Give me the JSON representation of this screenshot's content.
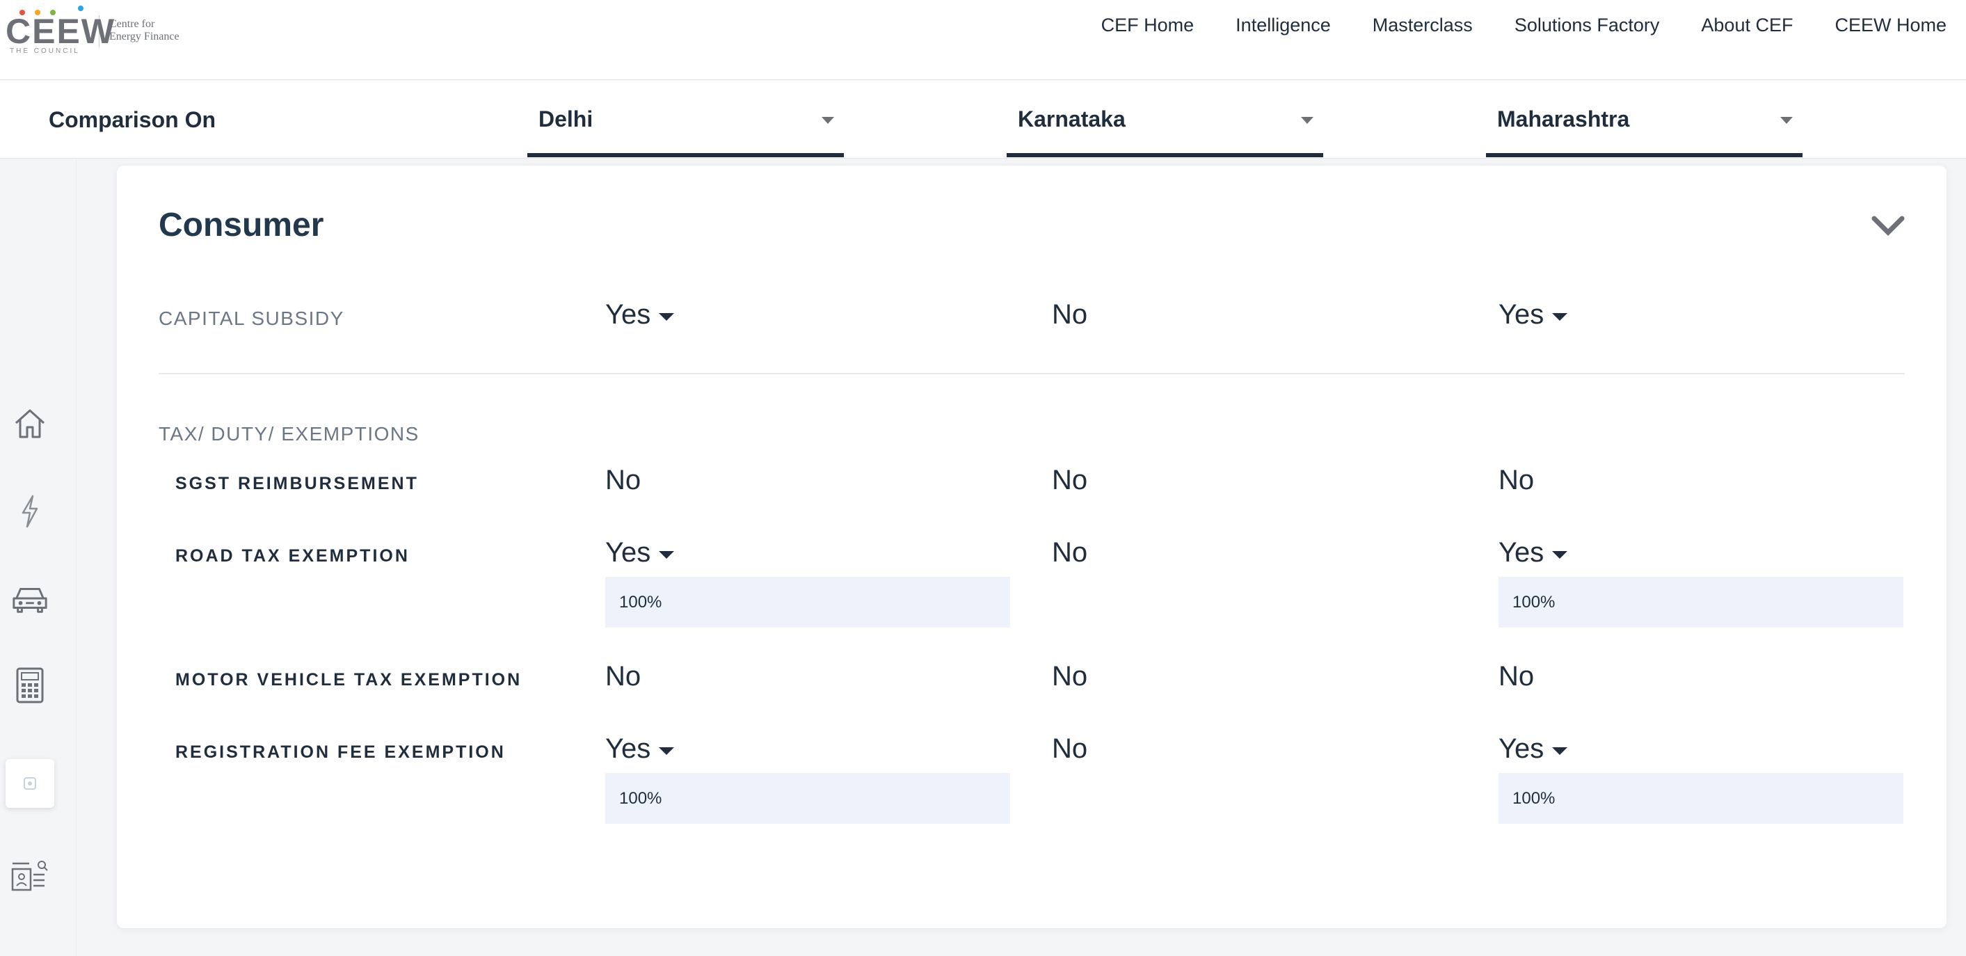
{
  "header": {
    "logo": {
      "wordmark": "CEEW",
      "sub": "THE COUNCIL",
      "tagline_line1": "Centre for",
      "tagline_line2": "Energy Finance"
    },
    "nav": [
      "CEF Home",
      "Intelligence",
      "Masterclass",
      "Solutions Factory",
      "About CEF",
      "CEEW Home"
    ]
  },
  "comparison": {
    "label": "Comparison On",
    "states": [
      "Delhi",
      "Karnataka",
      "Maharashtra"
    ]
  },
  "sidebar": {
    "icons": [
      "home-icon",
      "lightning-icon",
      "car-icon",
      "calculator-icon",
      "document-icon",
      "profile-card-icon"
    ],
    "active_index": 4
  },
  "section": {
    "title": "Consumer",
    "capital_subsidy": {
      "label": "CAPITAL SUBSIDY",
      "values": [
        "Yes",
        "No",
        "Yes"
      ]
    },
    "tax": {
      "label": "TAX/ DUTY/ EXEMPTIONS",
      "rows": [
        {
          "label": "SGST REIMBURSEMENT",
          "values": [
            "No",
            "No",
            "No"
          ],
          "details": [
            "",
            "",
            ""
          ]
        },
        {
          "label": "ROAD TAX EXEMPTION",
          "values": [
            "Yes",
            "No",
            "Yes"
          ],
          "details": [
            "100%",
            "",
            "100%"
          ]
        },
        {
          "label": "MOTOR VEHICLE TAX EXEMPTION",
          "values": [
            "No",
            "No",
            "No"
          ],
          "details": [
            "",
            "",
            ""
          ]
        },
        {
          "label": "REGISTRATION FEE EXEMPTION",
          "values": [
            "Yes",
            "No",
            "Yes"
          ],
          "details": [
            "100%",
            "",
            "100%"
          ]
        }
      ]
    }
  },
  "colors": {
    "accent": "#1f2d3d",
    "detail_bg": "#eef3fb",
    "muted": "#6b7785",
    "logo_dots": [
      "#e94f3d",
      "#f5a623",
      "#7cb342",
      "#29a8e0"
    ]
  }
}
